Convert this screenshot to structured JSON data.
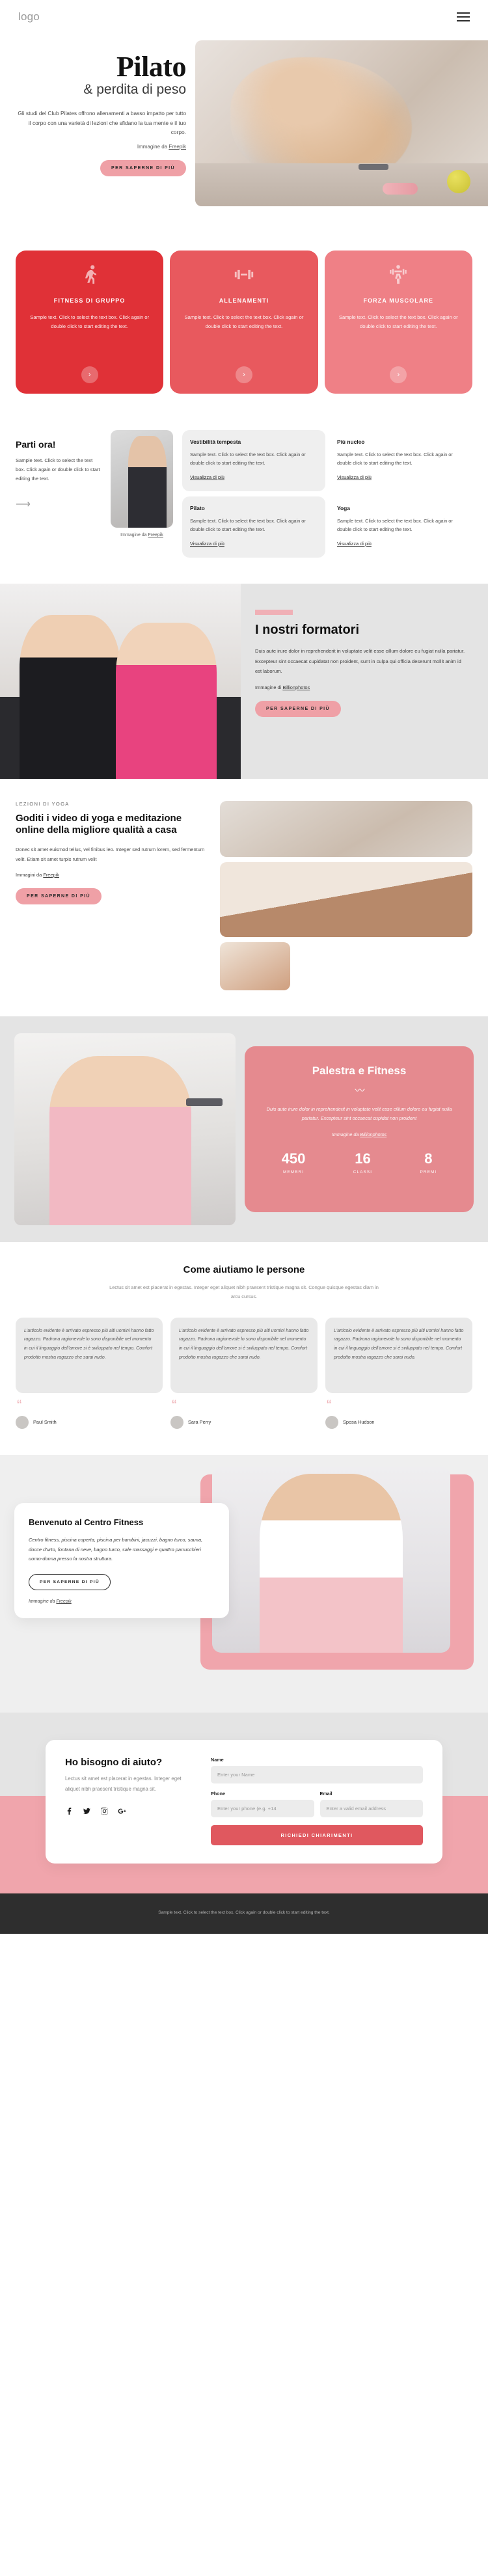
{
  "header": {
    "logo": "logo",
    "menu_icon": "hamburger-menu-icon"
  },
  "hero": {
    "title": "Pilato",
    "subtitle": "& perdita di peso",
    "description": "Gli studi del Club Pilates offrono allenamenti a basso impatto per tutto il corpo con una varietà di lezioni che sfidano la tua mente e il tuo corpo.",
    "credit_prefix": "Immagine da ",
    "credit_link": "Freepik",
    "cta": "PER SAPERNE DI PIÙ"
  },
  "cards": [
    {
      "title": "FITNESS DI GRUPPO",
      "text": "Sample text. Click to select the text box. Click again or double click to start editing the text.",
      "icon": "stretching-person-icon",
      "color": "#e03137",
      "arrow": "›"
    },
    {
      "title": "ALLENAMENTI",
      "text": "Sample text. Click to select the text box. Click again or double click to start editing the text.",
      "icon": "dumbbell-icon",
      "color": "#e8595e",
      "arrow": "›"
    },
    {
      "title": "FORZA MUSCOLARE",
      "text": "Sample text. Click to select the text box. Click again or double click to start editing the text.",
      "icon": "weightlifter-icon",
      "color": "#ef8086",
      "arrow": "›"
    }
  ],
  "parti": {
    "heading": "Parti ora!",
    "text": "Sample text. Click to select the text box. Click again or double click to start editing the text.",
    "arrow": "⟶",
    "image_credit_prefix": "Immagine da ",
    "image_credit_link": "Freepik",
    "features": [
      {
        "title": "Vestibilità tempesta",
        "text": "Sample text. Click to select the text box. Click again or double click to start editing the text.",
        "link": "Visualizza di più"
      },
      {
        "title": "Più nucleo",
        "text": "Sample text. Click to select the text box. Click again or double click to start editing the text.",
        "link": "Visualizza di più"
      },
      {
        "title": "Pilato",
        "text": "Sample text. Click to select the text box. Click again or double click to start editing the text.",
        "link": "Visualizza di più"
      },
      {
        "title": "Yoga",
        "text": "Sample text. Click to select the text box. Click again or double click to start editing the text.",
        "link": "Visualizza di più"
      }
    ]
  },
  "formatori": {
    "heading": "I nostri formatori",
    "text": "Duis aute irure dolor in reprehenderit in voluptate velit esse cillum dolore eu fugiat nulla pariatur. Excepteur sint occaecat cupidatat non proident, sunt in culpa qui officia deserunt mollit anim id est laborum.",
    "credit_prefix": "Immagine di ",
    "credit_link": "Billionphotos",
    "cta": "PER SAPERNE DI PIÙ"
  },
  "yoga": {
    "kicker": "LEZIONI DI YOGA",
    "heading": "Goditi i video di yoga e meditazione online della migliore qualità a casa",
    "text": "Donec sit amet euismod tellus, vel finibus leo. Integer sed rutrum lorem, sed fermentum velit. Etiam sit amet turpis rutrum velit",
    "credit_prefix": "Immagini da ",
    "credit_link": "Freepik",
    "cta": "PER SAPERNE DI PIÙ"
  },
  "palestra": {
    "heading": "Palestra e Fitness",
    "divider": "〰",
    "text": "Duis aute irure dolor in reprehenderit in voluptate velit esse cillum dolore eu fugiat nulla pariatur. Excepteur sint occaecat cupidat non proident",
    "credit_prefix": "Immagine da ",
    "credit_link": "Billionphotos",
    "stats": [
      {
        "number": "450",
        "label": "MEMBRI"
      },
      {
        "number": "16",
        "label": "CLASSI"
      },
      {
        "number": "8",
        "label": "PREMI"
      }
    ]
  },
  "testimonials": {
    "heading": "Come aiutiamo le persone",
    "subheading": "Lectus sit amet est placerat in egestas. Integer eget aliquet nibh praesent tristique magna sit. Congue quisque egestas diam in arcu cursus.",
    "quote_mark": "“",
    "items": [
      {
        "text": "L'articolo evidente è arrivato espresso più alti uomini hanno fatto ragazzo. Padrona ragionevole lo sono disponibile nel momento in cui il linguaggio dell'amore si è sviluppato nel tempo. Comfort prodotto mostra ragazzo che sarai nudo.",
        "name": "Paul Smith"
      },
      {
        "text": "L'articolo evidente è arrivato espresso più alti uomini hanno fatto ragazzo. Padrona ragionevole lo sono disponibile nel momento in cui il linguaggio dell'amore si è sviluppato nel tempo. Comfort prodotto mostra ragazzo che sarai nudo.",
        "name": "Sara Perry"
      },
      {
        "text": "L'articolo evidente è arrivato espresso più alti uomini hanno fatto ragazzo. Padrona ragionevole lo sono disponibile nel momento in cui il linguaggio dell'amore si è sviluppato nel tempo. Comfort prodotto mostra ragazzo che sarai nudo.",
        "name": "Sposa Hudson"
      }
    ]
  },
  "benvenuto": {
    "heading": "Benvenuto al Centro Fitness",
    "text": "Centro fitness, piscina coperta, piscina per bambini, jacuzzi, bagno turco, sauna, docce d'urto, fontana di neve, bagno turco, sale massaggi e quattro parrucchieri uomo-donna presso la nostra struttura.",
    "cta": "PER SAPERNE DI PIÙ",
    "credit_prefix": "Immagine da ",
    "credit_link": "Freepik"
  },
  "contact": {
    "heading": "Ho bisogno di aiuto?",
    "text": "Lectus sit amet est placerat in egestas. Integer eget aliquet nibh praesent tristique magna sit.",
    "socials": [
      "facebook-icon",
      "twitter-icon",
      "instagram-icon",
      "google-plus-icon"
    ],
    "fields": {
      "name_label": "Name",
      "name_placeholder": "Enter your Name",
      "phone_label": "Phone",
      "phone_placeholder": "Enter your phone (e.g. +14",
      "email_label": "Email",
      "email_placeholder": "Enter a valid email address"
    },
    "submit": "RICHIEDI CHIARIMENTI"
  },
  "footer": {
    "text": "Sample text. Click to select the text box. Click again or double click to start editing the text."
  },
  "colors": {
    "accent_red": "#e03137",
    "accent_pink": "#f0a5ac",
    "soft_pink": "#e58a8f",
    "dark": "#2e2e2e"
  }
}
